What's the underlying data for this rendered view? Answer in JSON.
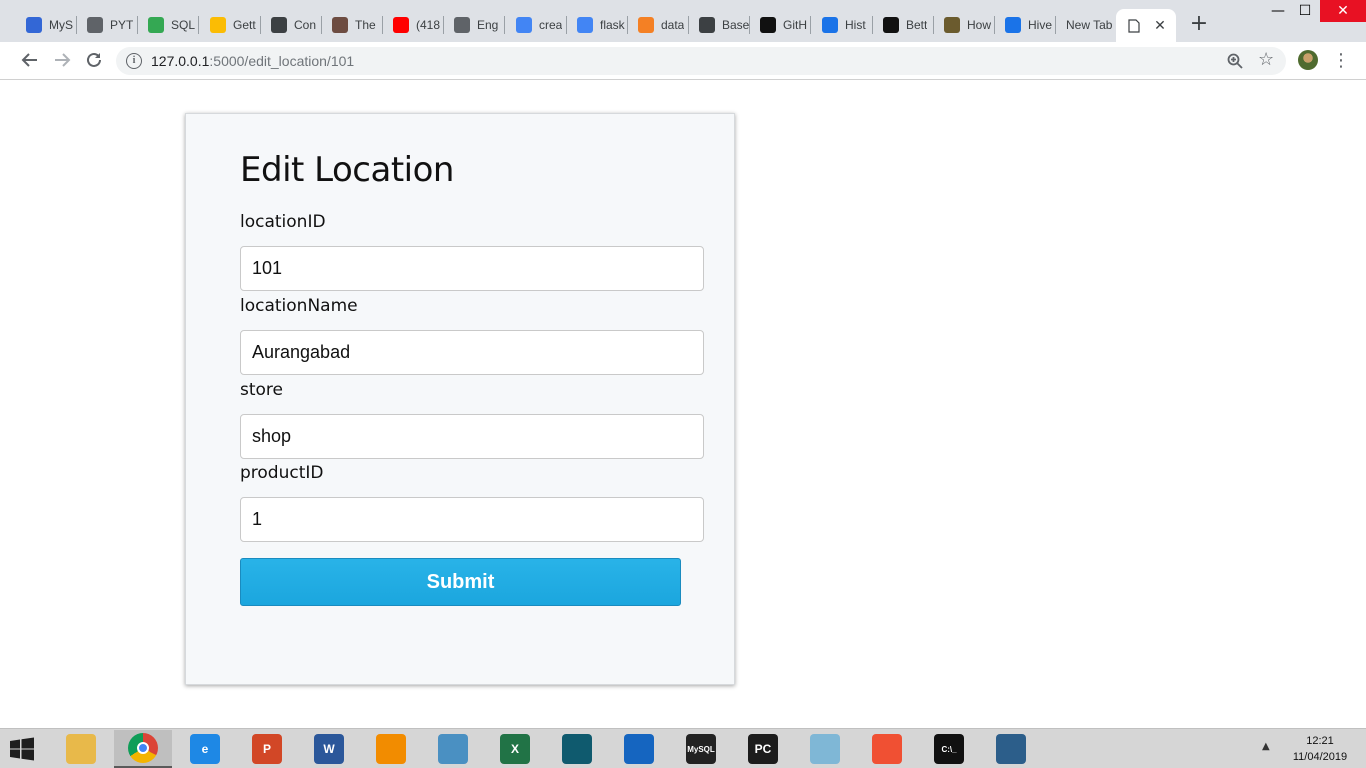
{
  "browser": {
    "tabs": [
      {
        "label": "MyS",
        "icon": "mysql-a-icon",
        "color": "#3367d6"
      },
      {
        "label": "PYT",
        "icon": "pyt-icon",
        "color": "#5f6368"
      },
      {
        "label": "SQL",
        "icon": "sql-icon",
        "color": "#34a853"
      },
      {
        "label": "Gett",
        "icon": "google-cloud-icon",
        "color": "#fbbc04"
      },
      {
        "label": "Con",
        "icon": "phone-icon",
        "color": "#3c4043"
      },
      {
        "label": "The",
        "icon": "book-icon",
        "color": "#6d4c41"
      },
      {
        "label": "(418",
        "icon": "youtube-icon",
        "color": "#ff0000"
      },
      {
        "label": "Eng",
        "icon": "eng-icon",
        "color": "#5f6368"
      },
      {
        "label": "crea",
        "icon": "google-icon",
        "color": "#4285f4"
      },
      {
        "label": "flask",
        "icon": "google-icon",
        "color": "#4285f4"
      },
      {
        "label": "data",
        "icon": "stackoverflow-icon",
        "color": "#f48024"
      },
      {
        "label": "Base",
        "icon": "base-icon",
        "color": "#3c4043"
      },
      {
        "label": "GitH",
        "icon": "github-icon",
        "color": "#111111"
      },
      {
        "label": "Hist",
        "icon": "history-icon",
        "color": "#1a73e8"
      },
      {
        "label": "Bett",
        "icon": "medium-icon",
        "color": "#111111"
      },
      {
        "label": "How",
        "icon": "how-icon",
        "color": "#6b5b2e"
      },
      {
        "label": "Hive",
        "icon": "hive-icon",
        "color": "#1a73e8"
      },
      {
        "label": "New Tab",
        "icon": "",
        "color": ""
      }
    ],
    "active_tab_label": "",
    "url_host": "127.0.0.1",
    "url_path": ":5000/edit_location/101"
  },
  "form": {
    "title": "Edit Location",
    "fields": [
      {
        "label": "locationID",
        "value": "101"
      },
      {
        "label": "locationName",
        "value": "Aurangabad"
      },
      {
        "label": "store",
        "value": "shop"
      },
      {
        "label": "productID",
        "value": "1"
      }
    ],
    "submit_label": "Submit"
  },
  "taskbar": {
    "apps": [
      {
        "name": "file-explorer",
        "label": "",
        "color": "#e8b94a"
      },
      {
        "name": "chrome",
        "label": "",
        "color": "#db4437"
      },
      {
        "name": "internet-explorer",
        "label": "e",
        "color": "#1e88e5"
      },
      {
        "name": "powerpoint",
        "label": "P",
        "color": "#d24726"
      },
      {
        "name": "word",
        "label": "W",
        "color": "#2b579a"
      },
      {
        "name": "vlc",
        "label": "",
        "color": "#f28c00"
      },
      {
        "name": "remote-desktop",
        "label": "",
        "color": "#4a90c2"
      },
      {
        "name": "excel",
        "label": "X",
        "color": "#217346"
      },
      {
        "name": "book-app",
        "label": "",
        "color": "#0f5a6e"
      },
      {
        "name": "audacity",
        "label": "",
        "color": "#1565c0"
      },
      {
        "name": "mysql-shell",
        "label": "MySQL",
        "color": "#222222"
      },
      {
        "name": "pycharm",
        "label": "PC",
        "color": "#1c1c1c"
      },
      {
        "name": "notepad",
        "label": "",
        "color": "#7fb7d6"
      },
      {
        "name": "git-gui",
        "label": "",
        "color": "#f05033"
      },
      {
        "name": "command-prompt",
        "label": "C:\\_",
        "color": "#111111"
      },
      {
        "name": "mysql-workbench",
        "label": "",
        "color": "#2c5e8a"
      }
    ],
    "time": "12:21",
    "date": "11/04/2019"
  }
}
